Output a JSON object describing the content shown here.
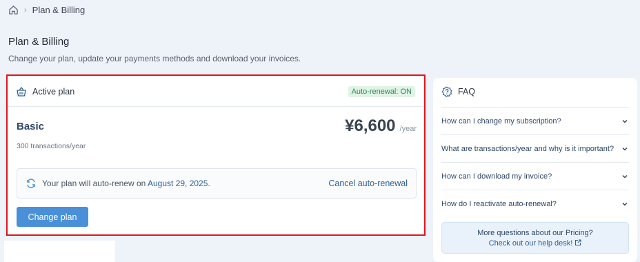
{
  "breadcrumb": {
    "current": "Plan & Billing"
  },
  "page": {
    "title": "Plan & Billing",
    "subtitle": "Change your plan, update your payments methods and download your invoices."
  },
  "plan": {
    "header": "Active plan",
    "badge": "Auto-renewal: ON",
    "name": "Basic",
    "price": "¥6,600",
    "period": "/year",
    "meta": "300 transactions/year",
    "renew_text": "Your plan will auto-renew on",
    "renew_date": "August 29, 2025.",
    "cancel_label": "Cancel auto-renewal",
    "change_label": "Change plan"
  },
  "faq": {
    "title": "FAQ",
    "items": [
      "How can I change my subscription?",
      "What are transactions/year and why is it important?",
      "How can I download my invoice?",
      "How do I reactivate auto-renewal?"
    ],
    "help_title": "More questions about our Pricing?",
    "help_link": "Check out our help desk!"
  },
  "colors": {
    "accent": "#4a90d9",
    "link": "#2e5f95",
    "highlight": "#e0141c",
    "badge_bg": "#dff3e6",
    "badge_text": "#2f8b55"
  }
}
